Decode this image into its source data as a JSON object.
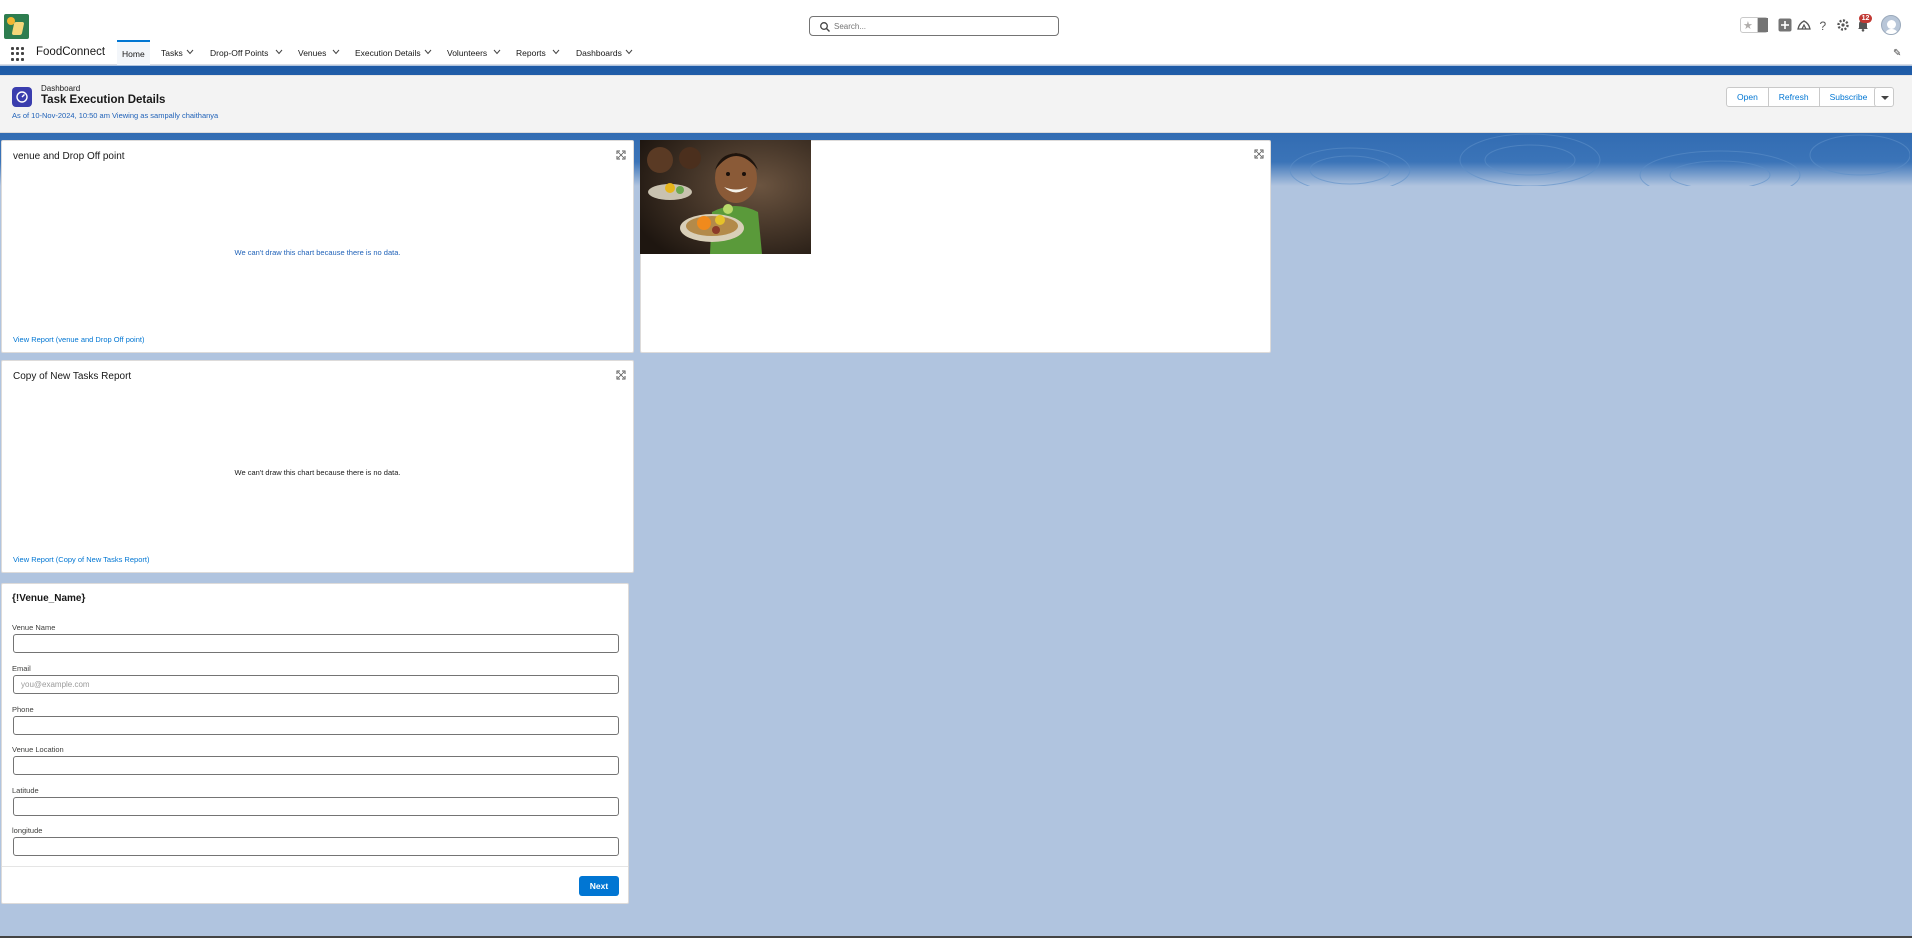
{
  "header": {
    "app_logo": "foodconnect-logo",
    "search_placeholder": "Search...",
    "notification_count": "12",
    "icons": [
      "favorites-star-icon",
      "favorites-dropdown-icon",
      "add-icon",
      "trailhead-icon",
      "help-icon",
      "setup-gear-icon",
      "notifications-bell-icon",
      "user-avatar"
    ]
  },
  "nav": {
    "app_name": "FoodConnect",
    "items": [
      {
        "label": "Home",
        "active": true
      },
      {
        "label": "Tasks"
      },
      {
        "label": "Drop-Off Points"
      },
      {
        "label": "Venues"
      },
      {
        "label": "Execution Details"
      },
      {
        "label": "Volunteers"
      },
      {
        "label": "Reports"
      },
      {
        "label": "Dashboards"
      }
    ]
  },
  "dashboard": {
    "type_label": "Dashboard",
    "title": "Task Execution Details",
    "meta": "As of 10-Nov-2024, 10:50 am Viewing as sampally chaithanya",
    "buttons": {
      "open": "Open",
      "refresh": "Refresh",
      "subscribe": "Subscribe"
    }
  },
  "widgets": [
    {
      "title": "venue and Drop Off point",
      "no_data": "We can't draw this chart because there is no data.",
      "link": "View Report (venue and Drop Off point)"
    },
    {
      "title": "Copy of New Tasks Report",
      "no_data": "We can't draw this chart because there is no data.",
      "link": "View Report (Copy of New Tasks Report)"
    }
  ],
  "image_widget": {
    "image": "smiling-child-with-food-plate-photo"
  },
  "form": {
    "title": "{!Venue_Name}",
    "fields": [
      {
        "label": "Venue Name",
        "value": "",
        "placeholder": ""
      },
      {
        "label": "Email",
        "value": "",
        "placeholder": "you@example.com"
      },
      {
        "label": "Phone",
        "value": "",
        "placeholder": ""
      },
      {
        "label": "Venue Location",
        "value": "",
        "placeholder": ""
      },
      {
        "label": "Latitude",
        "value": "",
        "placeholder": ""
      },
      {
        "label": "longitude",
        "value": "",
        "placeholder": ""
      }
    ],
    "next_label": "Next"
  },
  "colors": {
    "brand_blue": "#0176d3",
    "link_blue": "#0176d3",
    "background": "#b0c4df"
  }
}
